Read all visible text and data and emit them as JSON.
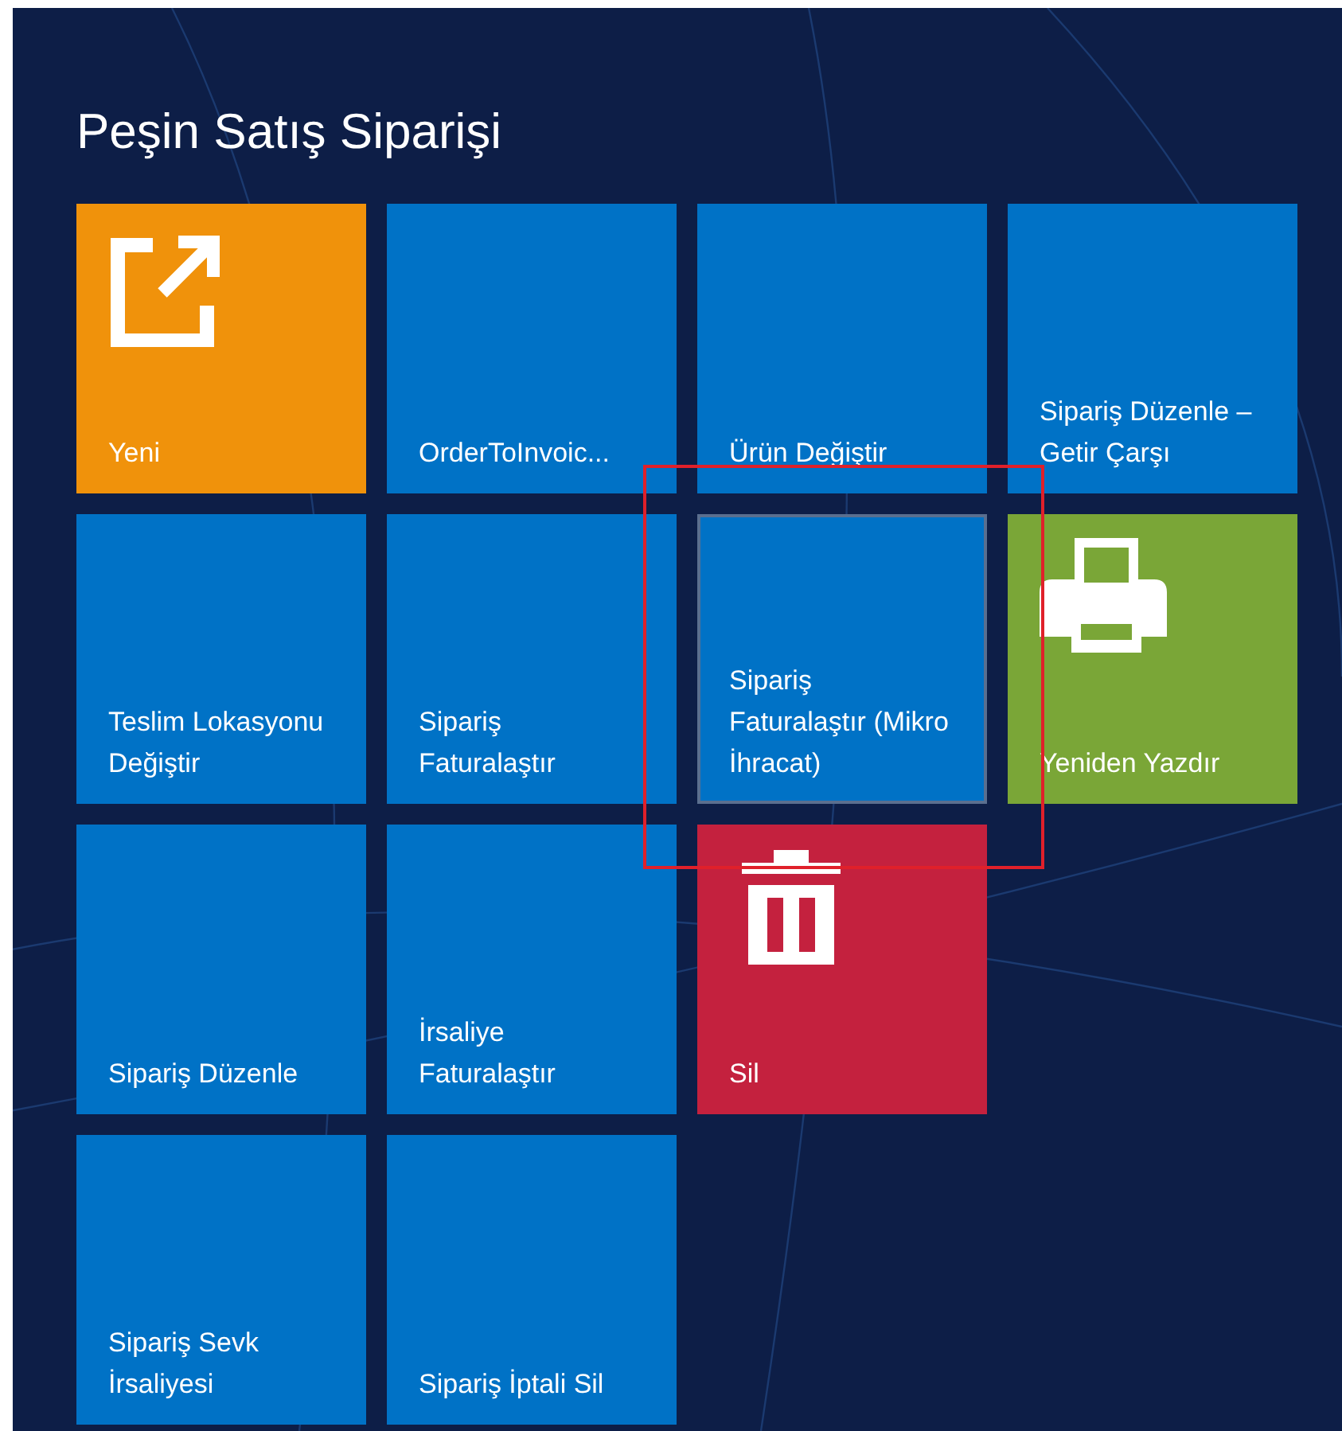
{
  "title": "Peşin Satış Siparişi",
  "rows": [
    {
      "tiles": [
        {
          "kind": "new",
          "label": "Yeni",
          "color": "#f0920b",
          "selected": false
        },
        {
          "kind": "plain",
          "label": "OrderToInvoic...",
          "color": "#0072c6",
          "selected": false
        },
        {
          "kind": "plain",
          "label": "Ürün Değiştir",
          "color": "#0072c6",
          "selected": false
        },
        {
          "kind": "plain",
          "label": "Sipariş Düzenle – Getir Çarşı",
          "color": "#0072c6",
          "selected": false
        }
      ]
    },
    {
      "tiles": [
        {
          "kind": "plain",
          "label": "Teslim Lokasyonu Değiştir",
          "color": "#0072c6",
          "selected": false
        },
        {
          "kind": "plain",
          "label": "Sipariş Faturalaştır",
          "color": "#0072c6",
          "selected": false
        },
        {
          "kind": "plain",
          "label": "Sipariş Faturalaştır (Mikro İhracat)",
          "color": "#0072c6",
          "selected": true
        },
        {
          "kind": "print",
          "label": "Yeniden Yazdır",
          "color": "#7aa637",
          "selected": false
        }
      ]
    },
    {
      "tiles": [
        {
          "kind": "plain",
          "label": "Sipariş Düzenle",
          "color": "#0072c6",
          "selected": false
        },
        {
          "kind": "plain",
          "label": "İrsaliye Faturalaştır",
          "color": "#0072c6",
          "selected": false
        },
        {
          "kind": "delete",
          "label": "Sil",
          "color": "#c4213e",
          "selected": false
        }
      ]
    },
    {
      "tiles": [
        {
          "kind": "plain",
          "label": "Sipariş Sevk İrsaliyesi",
          "color": "#0072c6",
          "selected": false
        },
        {
          "kind": "plain",
          "label": "Sipariş İptali Sil",
          "color": "#0072c6",
          "selected": false
        }
      ]
    }
  ]
}
